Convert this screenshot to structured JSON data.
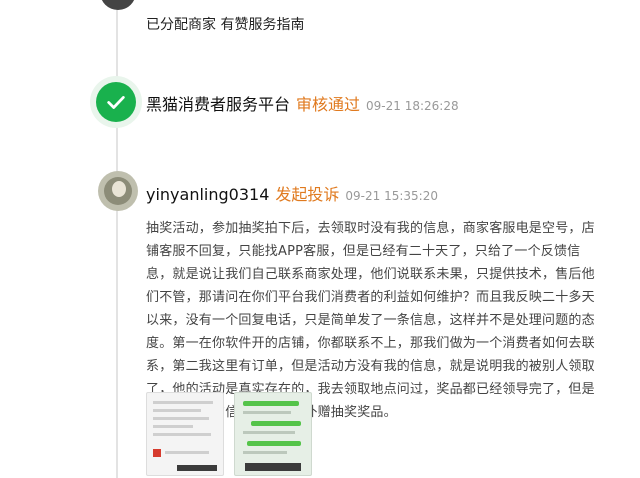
{
  "top_item": {
    "merchants_label": "已分配商家 有赞服务指南"
  },
  "platform_item": {
    "name": "黑猫消费者服务平台",
    "status": "审核通过",
    "time": "09-21 18:26:28"
  },
  "complaint_item": {
    "username": "yinyanling0314",
    "action": "发起投诉",
    "time": "09-21 15:35:20",
    "text": "抽奖活动，参加抽奖拍下后，去领取时没有我的信息，商家客服电是空号，店铺客服不回复，只能找APP客服，但是已经有二十天了，只给了一个反馈信息，就是说让我们自己联系商家处理，他们说联系未果，只提供技术，售后他们不管，那请问在你们平台我们消费者的利益如何维护？而且我反映二十多天以来，没有一个回复电话，只是简单发了一条信息，这样并不是处理问题的态度。第一在你软件开的店铺，你都联系不上，那我们做为一个消费者如何去联系，第二我这里有订单，但是活动方没有我的信息，就是说明我的被别人领取了，他的活动是真实存在的，我去领取地点问过，奖品都已经领导完了，但是就是没有我的信息。现要求补赠抽奖奖品。"
  },
  "colors": {
    "accent": "#e07a1f",
    "success": "#19b14d",
    "muted": "#999999"
  }
}
